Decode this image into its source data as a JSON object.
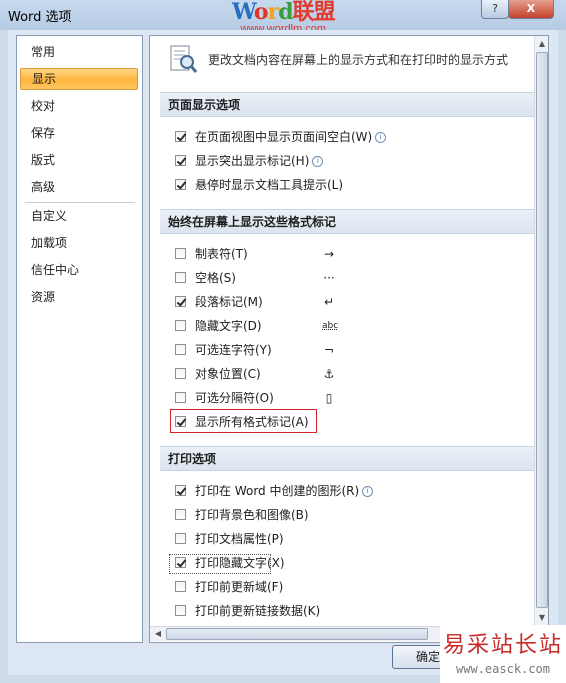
{
  "window": {
    "title": "Word 选项",
    "help_label": "?",
    "close_label": "X"
  },
  "watermark_top": {
    "brand_w": "W",
    "brand_o": "o",
    "brand_r": "r",
    "brand_d": "d",
    "brand_cn": "联盟",
    "url": "www.wordlm.com"
  },
  "watermark_bottom": {
    "title": "易采站长站",
    "url": "www.easck.com"
  },
  "nav": {
    "items": [
      {
        "label": "常用"
      },
      {
        "label": "显示"
      },
      {
        "label": "校对"
      },
      {
        "label": "保存"
      },
      {
        "label": "版式"
      },
      {
        "label": "高级"
      },
      {
        "label": "自定义"
      },
      {
        "label": "加载项"
      },
      {
        "label": "信任中心"
      },
      {
        "label": "资源"
      }
    ],
    "selected": "显示"
  },
  "intro": {
    "text": "更改文档内容在屏幕上的显示方式和在打印时的显示方式"
  },
  "sections": {
    "page_display": {
      "title": "页面显示选项",
      "options": [
        {
          "label": "在页面视图中显示页面间空白(W)",
          "checked": true
        },
        {
          "label": "显示突出显示标记(H)",
          "checked": true
        },
        {
          "label": "悬停时显示文档工具提示(L)",
          "checked": true
        }
      ]
    },
    "format_marks": {
      "title": "始终在屏幕上显示这些格式标记",
      "options": [
        {
          "label": "制表符(T)",
          "checked": false,
          "symbol": "→"
        },
        {
          "label": "空格(S)",
          "checked": false,
          "symbol": "···"
        },
        {
          "label": "段落标记(M)",
          "checked": true,
          "symbol": "↵"
        },
        {
          "label": "隐藏文字(D)",
          "checked": false,
          "symbol": "abc"
        },
        {
          "label": "可选连字符(Y)",
          "checked": false,
          "symbol": "¬"
        },
        {
          "label": "对象位置(C)",
          "checked": false,
          "symbol": "⚓"
        },
        {
          "label": "可选分隔符(O)",
          "checked": false,
          "symbol": "▯"
        },
        {
          "label": "显示所有格式标记(A)",
          "checked": true
        }
      ]
    },
    "print": {
      "title": "打印选项",
      "options": [
        {
          "label": "打印在 Word 中创建的图形(R)",
          "checked": true
        },
        {
          "label": "打印背景色和图像(B)",
          "checked": false
        },
        {
          "label": "打印文档属性(P)",
          "checked": false
        },
        {
          "label": "打印隐藏文字(X)",
          "checked": true
        },
        {
          "label": "打印前更新域(F)",
          "checked": false
        },
        {
          "label": "打印前更新链接数据(K)",
          "checked": false
        }
      ]
    }
  },
  "buttons": {
    "ok": "确定"
  },
  "colors": {
    "selected_nav": "#ffb43c",
    "highlight_border": "#d0252b"
  }
}
